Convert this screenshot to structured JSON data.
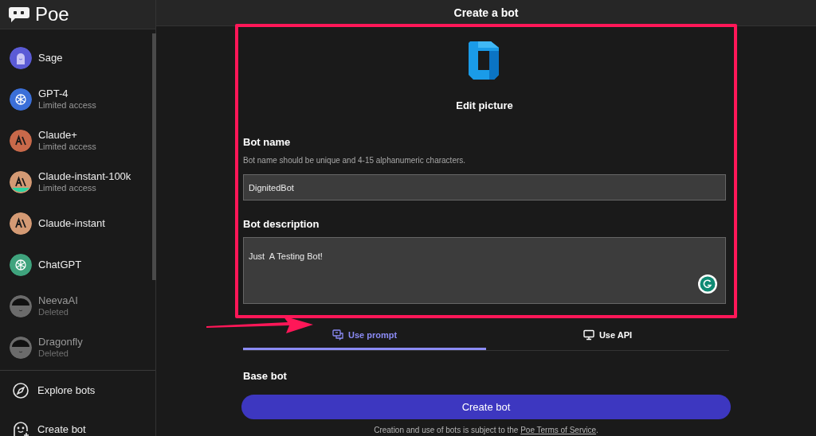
{
  "app": {
    "name": "Poe"
  },
  "sidebar": {
    "bots": [
      {
        "name": "Sage",
        "kind": "sage",
        "color": "#5b5bd6",
        "deleted": false
      },
      {
        "name": "GPT-4",
        "subtitle": "Limited access",
        "kind": "openai",
        "color": "#3b6fd8",
        "deleted": false
      },
      {
        "name": "Claude+",
        "subtitle": "Limited access",
        "kind": "anthropic",
        "color": "#c8694a",
        "deleted": false
      },
      {
        "name": "Claude-instant-100k",
        "subtitle": "Limited access",
        "kind": "anthropic-100k",
        "color": "#d49a74",
        "deleted": false
      },
      {
        "name": "Claude-instant",
        "kind": "anthropic",
        "color": "#d49a74",
        "deleted": false
      },
      {
        "name": "ChatGPT",
        "kind": "openai",
        "color": "#3fa37d",
        "deleted": false
      },
      {
        "name": "NeevaAI",
        "subtitle": "Deleted",
        "kind": "person",
        "color": "#6b6b6b",
        "deleted": true
      },
      {
        "name": "Dragonfly",
        "subtitle": "Deleted",
        "kind": "person",
        "color": "#6b6b6b",
        "deleted": true
      }
    ],
    "actions": [
      {
        "label": "Explore bots",
        "kind": "explore"
      },
      {
        "label": "Create bot",
        "kind": "create"
      }
    ]
  },
  "header": {
    "title": "Create a bot"
  },
  "form": {
    "edit_picture": "Edit picture",
    "bot_name": {
      "label": "Bot name",
      "hint": "Bot name should be unique and 4-15 alphanumeric characters.",
      "value": "DignitedBot"
    },
    "bot_description": {
      "label": "Bot description",
      "value": "Just  A Testing Bot!"
    }
  },
  "tabs": [
    {
      "label": "Use prompt",
      "kind": "prompt",
      "selected": true
    },
    {
      "label": "Use API",
      "kind": "api",
      "selected": false
    }
  ],
  "base_bot": {
    "label": "Base bot"
  },
  "create_button": "Create bot",
  "footer": {
    "text": "Creation and use of bots is subject to the ",
    "link": "Poe Terms of Service",
    "end": "."
  }
}
